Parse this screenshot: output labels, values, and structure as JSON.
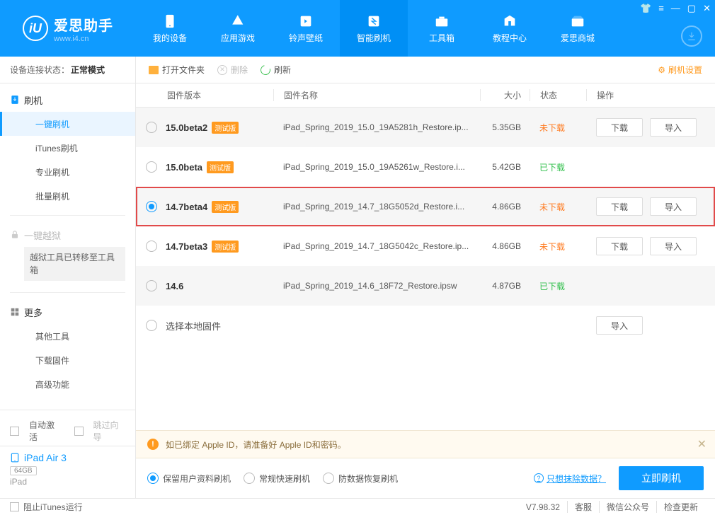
{
  "brand": {
    "name": "爱思助手",
    "site": "www.i4.cn"
  },
  "nav": [
    {
      "label": "我的设备"
    },
    {
      "label": "应用游戏"
    },
    {
      "label": "铃声壁纸"
    },
    {
      "label": "智能刷机"
    },
    {
      "label": "工具箱"
    },
    {
      "label": "教程中心"
    },
    {
      "label": "爱思商城"
    }
  ],
  "activeNavIndex": 3,
  "statusLabel": "设备连接状态：",
  "statusValue": "正常模式",
  "side": {
    "flash": {
      "title": "刷机",
      "items": [
        "一键刷机",
        "iTunes刷机",
        "专业刷机",
        "批量刷机"
      ],
      "activeIndex": 0
    },
    "jailbreak": {
      "title": "一键越狱",
      "notice": "越狱工具已转移至工具箱"
    },
    "more": {
      "title": "更多",
      "items": [
        "其他工具",
        "下载固件",
        "高级功能"
      ]
    }
  },
  "bottomOptions": {
    "autoActivate": "自动激活",
    "skipGuide": "跳过向导"
  },
  "device": {
    "name": "iPad Air 3",
    "storage": "64GB",
    "type": "iPad"
  },
  "toolbar": {
    "openFolder": "打开文件夹",
    "delete": "删除",
    "refresh": "刷新",
    "settings": "刷机设置"
  },
  "columns": {
    "version": "固件版本",
    "name": "固件名称",
    "size": "大小",
    "status": "状态",
    "ops": "操作"
  },
  "betaTag": "测试版",
  "statusText": {
    "not": "未下载",
    "done": "已下载"
  },
  "opBtn": {
    "download": "下载",
    "import": "导入"
  },
  "rows": [
    {
      "version": "15.0beta2",
      "beta": true,
      "name": "iPad_Spring_2019_15.0_19A5281h_Restore.ip...",
      "size": "5.35GB",
      "status": "not",
      "selected": false,
      "alt": true,
      "showDl": true
    },
    {
      "version": "15.0beta",
      "beta": true,
      "name": "iPad_Spring_2019_15.0_19A5261w_Restore.i...",
      "size": "5.42GB",
      "status": "done",
      "selected": false,
      "alt": false,
      "showDl": false
    },
    {
      "version": "14.7beta4",
      "beta": true,
      "name": "iPad_Spring_2019_14.7_18G5052d_Restore.i...",
      "size": "4.86GB",
      "status": "not",
      "selected": true,
      "alt": true,
      "highlighted": true,
      "showDl": true
    },
    {
      "version": "14.7beta3",
      "beta": true,
      "name": "iPad_Spring_2019_14.7_18G5042c_Restore.ip...",
      "size": "4.86GB",
      "status": "not",
      "selected": false,
      "alt": false,
      "showDl": true
    },
    {
      "version": "14.6",
      "beta": false,
      "name": "iPad_Spring_2019_14.6_18F72_Restore.ipsw",
      "size": "4.87GB",
      "status": "done",
      "selected": false,
      "alt": true,
      "showDl": false
    }
  ],
  "localRow": "选择本地固件",
  "warn": "如已绑定 Apple ID，请准备好 Apple ID和密码。",
  "flashOptions": [
    "保留用户资料刷机",
    "常规快速刷机",
    "防数据恢复刷机"
  ],
  "flashOptionActive": 0,
  "eraseLink": "只想抹除数据？",
  "flashNow": "立即刷机",
  "footer": {
    "blockItunes": "阻止iTunes运行",
    "version": "V7.98.32",
    "support": "客服",
    "wechat": "微信公众号",
    "update": "检查更新"
  }
}
